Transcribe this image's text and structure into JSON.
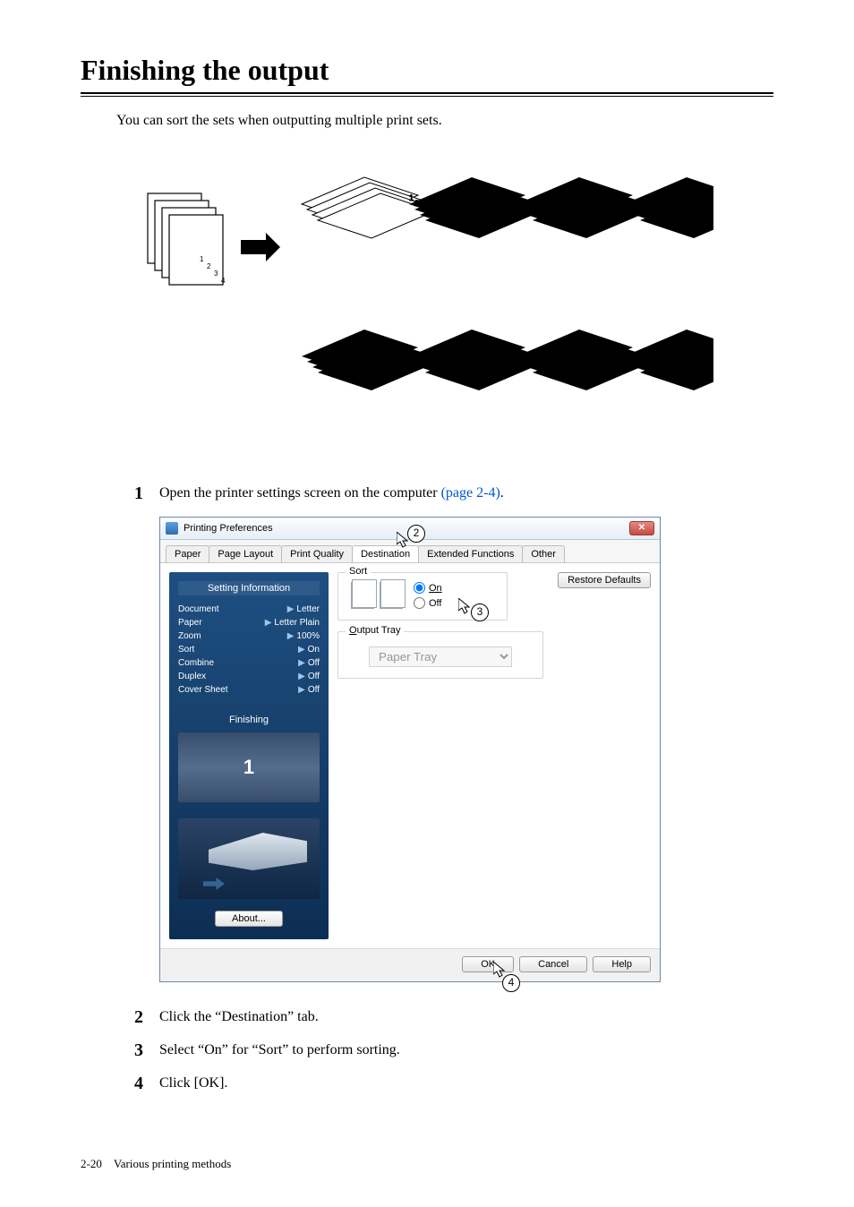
{
  "title": "Finishing the output",
  "intro": "You can sort the sets when outputting multiple print sets.",
  "steps": {
    "s1": {
      "num": "1",
      "text_before": "Open the printer settings screen on the computer ",
      "link": "(page 2-4)",
      "text_after": "."
    },
    "s2": {
      "num": "2",
      "text": "Click the “Destination” tab."
    },
    "s3": {
      "num": "3",
      "text": "Select “On” for “Sort” to perform sorting."
    },
    "s4": {
      "num": "4",
      "text": "Click [OK]."
    }
  },
  "dialog": {
    "window_title": "Printing Preferences",
    "close_glyph": "✕",
    "tabs": {
      "paper": "Paper",
      "page_layout": "Page Layout",
      "print_quality": "Print Quality",
      "destination": "Destination",
      "ext": "Extended Functions",
      "other": "Other"
    },
    "sidebar_title": "Setting Information",
    "rows": [
      {
        "k": "Document",
        "v": "Letter"
      },
      {
        "k": "Paper",
        "v": "Letter Plain"
      },
      {
        "k": "Zoom",
        "v": "100%"
      },
      {
        "k": "Sort",
        "v": "On"
      },
      {
        "k": "Combine",
        "v": "Off"
      },
      {
        "k": "Duplex",
        "v": "Off"
      },
      {
        "k": "Cover Sheet",
        "v": "Off"
      }
    ],
    "finishing_title": "Finishing",
    "finishing_one": "1",
    "about": "About...",
    "sort_label": "Sort",
    "sort_on": "On",
    "sort_off": "Off",
    "output_tray_label": "Output Tray",
    "output_tray_value": "Paper Tray",
    "restore": "Restore Defaults",
    "ok": "OK",
    "cancel": "Cancel",
    "help": "Help"
  },
  "callouts": {
    "c2": "2",
    "c3": "3",
    "c4": "4"
  },
  "footer": {
    "page": "2-20",
    "chapter": "Various printing methods"
  }
}
